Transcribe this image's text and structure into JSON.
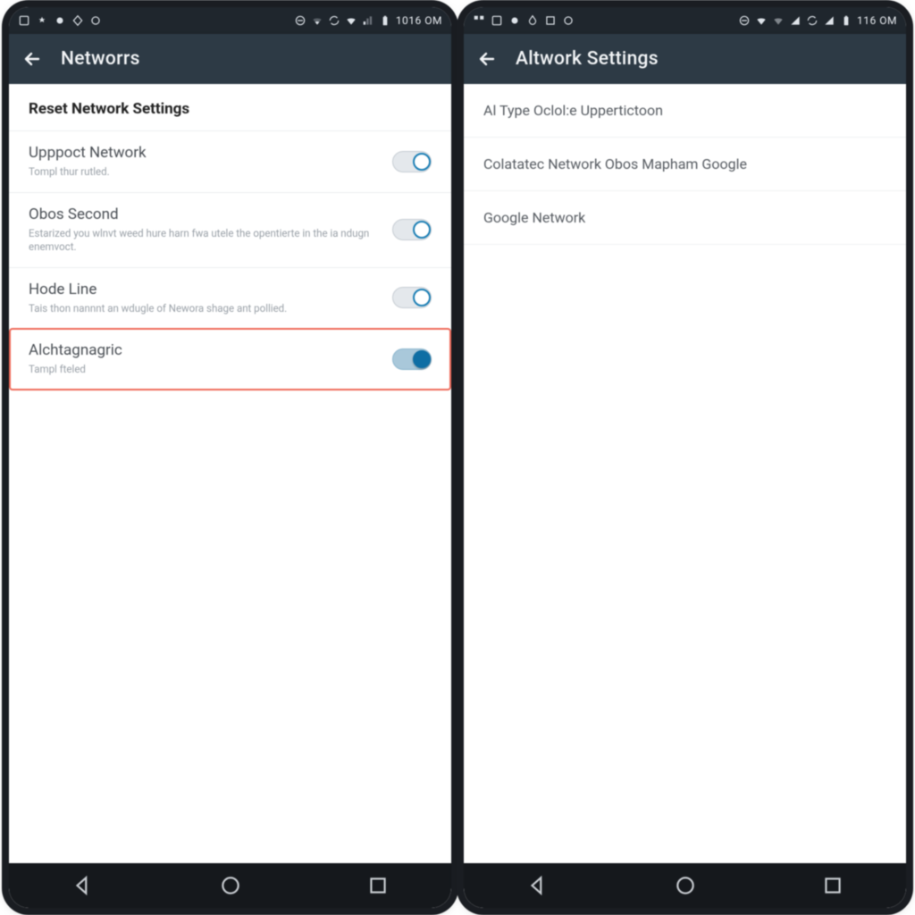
{
  "left": {
    "status": {
      "clock": "1016 OM"
    },
    "appbar": {
      "title": "Networrs"
    },
    "section_header": "Reset Network Settings",
    "rows": [
      {
        "title": "Upppoct Network",
        "sub": "Tompl thur rutled.",
        "on": false
      },
      {
        "title": "Obos Second",
        "sub": "Estarized you wlnvt weed hure harn fwa utele the opentierte in the ia ndugn enemvoct.",
        "on": false
      },
      {
        "title": "Hode Line",
        "sub": "Tais thon nannnt an wdugle of Newora shage ant pollied.",
        "on": false
      },
      {
        "title": "Alchtagnagric",
        "sub": "Tampl fteled",
        "on": true,
        "highlight": true
      }
    ]
  },
  "right": {
    "status": {
      "clock": "116 OM"
    },
    "appbar": {
      "title": "Altwork Settings"
    },
    "items": [
      "Al Type Oclol:e Uppertictoon",
      "Colatatec Network Obos Mapham Google",
      "Google Network"
    ]
  }
}
